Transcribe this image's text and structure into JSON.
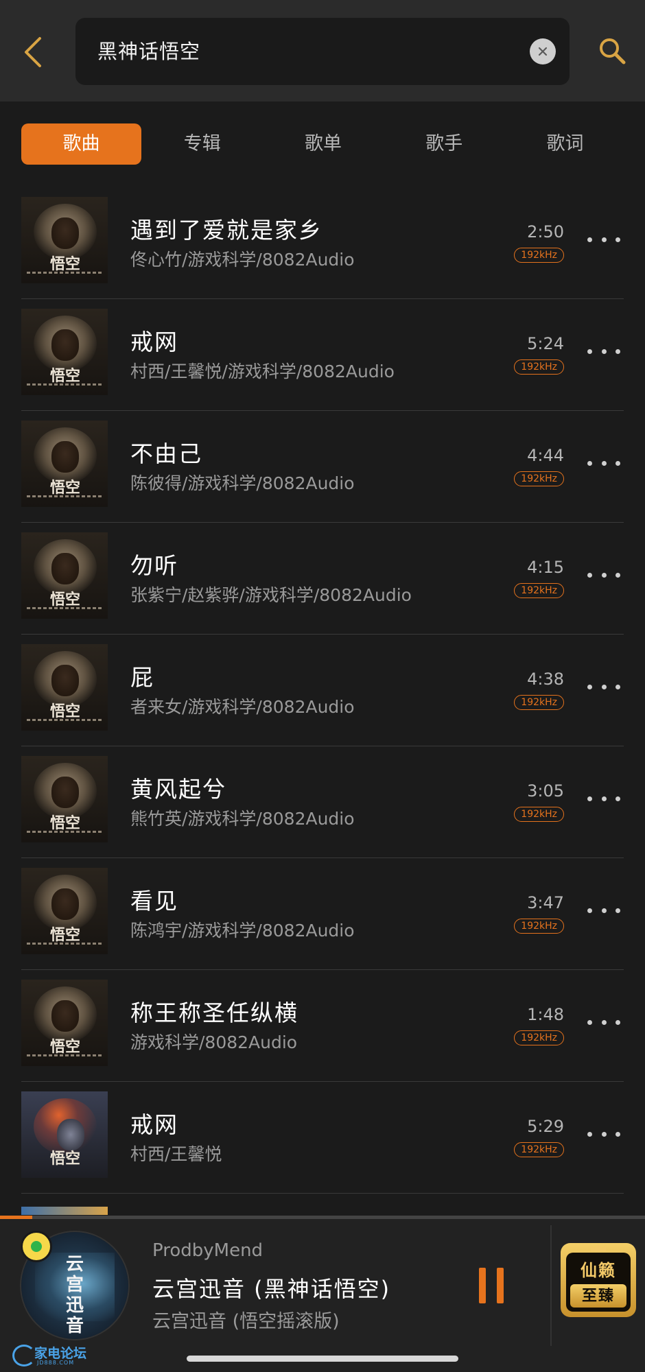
{
  "header": {
    "search_query": "黑神话悟空"
  },
  "tabs": [
    {
      "label": "歌曲",
      "active": true
    },
    {
      "label": "专辑",
      "active": false
    },
    {
      "label": "歌单",
      "active": false
    },
    {
      "label": "歌手",
      "active": false
    },
    {
      "label": "歌词",
      "active": false
    }
  ],
  "songs": [
    {
      "title": "遇到了爱就是家乡",
      "artist": "佟心竹/游戏科学/8082Audio",
      "duration": "2:50",
      "quality": "192kHz",
      "cover_glyph": "悟空"
    },
    {
      "title": "戒网",
      "artist": "村西/王馨悦/游戏科学/8082Audio",
      "duration": "5:24",
      "quality": "192kHz",
      "cover_glyph": "悟空"
    },
    {
      "title": "不由己",
      "artist": "陈彼得/游戏科学/8082Audio",
      "duration": "4:44",
      "quality": "192kHz",
      "cover_glyph": "悟空"
    },
    {
      "title": "勿听",
      "artist": "张紫宁/赵紫骅/游戏科学/8082Audio",
      "duration": "4:15",
      "quality": "192kHz",
      "cover_glyph": "悟空"
    },
    {
      "title": "屁",
      "artist": "者来女/游戏科学/8082Audio",
      "duration": "4:38",
      "quality": "192kHz",
      "cover_glyph": "悟空"
    },
    {
      "title": "黄风起兮",
      "artist": "熊竹英/游戏科学/8082Audio",
      "duration": "3:05",
      "quality": "192kHz",
      "cover_glyph": "悟空"
    },
    {
      "title": "看见",
      "artist": "陈鸿宇/游戏科学/8082Audio",
      "duration": "3:47",
      "quality": "192kHz",
      "cover_glyph": "悟空"
    },
    {
      "title": "称王称圣任纵横",
      "artist": "游戏科学/8082Audio",
      "duration": "1:48",
      "quality": "192kHz",
      "cover_glyph": "悟空"
    },
    {
      "title": "戒网",
      "artist": "村西/王馨悦",
      "duration": "5:29",
      "quality": "192kHz",
      "cover_glyph": "悟空"
    }
  ],
  "player": {
    "uploader": "ProdbyMend",
    "title": "云宫迅音 (黑神话悟空)",
    "album": "云宫迅音 (悟空摇滚版)",
    "progress": 0.05,
    "disc_text": "云宫迅音",
    "premium_top": "仙籁",
    "premium_bottom": "至臻"
  },
  "watermark": {
    "text": "家电论坛",
    "sub": "JD888.COM"
  },
  "colors": {
    "accent": "#e6731d",
    "background": "#1b1b1b",
    "header": "#2b2b2b"
  },
  "icons": {
    "back": "chevron-left-icon",
    "clear": "close-icon",
    "search": "search-icon",
    "more": "more-horizontal-icon",
    "pause": "pause-icon"
  }
}
